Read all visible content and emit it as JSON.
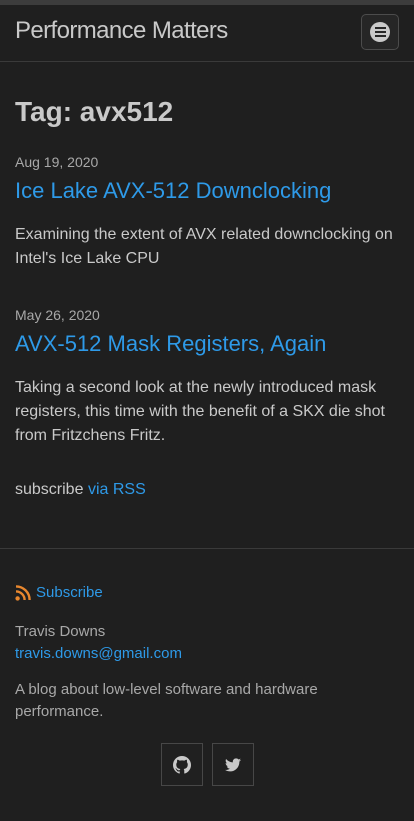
{
  "header": {
    "site_title": "Performance Matters",
    "menu_icon": "bars-circle-icon"
  },
  "page": {
    "heading": "Tag: avx512"
  },
  "posts": [
    {
      "date": "Aug 19, 2020",
      "title": "Ice Lake AVX-512 Downclocking",
      "excerpt": "Examining the extent of AVX related downclocking on Intel's Ice Lake CPU"
    },
    {
      "date": "May 26, 2020",
      "title": "AVX-512 Mask Registers, Again",
      "excerpt": "Taking a second look at the newly introduced mask registers, this time with the benefit of a SKX die shot from Fritzchens Fritz."
    }
  ],
  "subscribe": {
    "prefix": "subscribe",
    "link": "via RSS"
  },
  "footer": {
    "rss_label": "Subscribe",
    "rss_icon": "rss-icon",
    "author": "Travis Downs",
    "email": "travis.downs@gmail.com",
    "blurb": "A blog about low-level software and hardware performance.",
    "social": [
      "github-icon",
      "twitter-icon"
    ]
  },
  "colors": {
    "background": "#1f1f1f",
    "text": "#c9c9c9",
    "muted": "#a8a8a8",
    "link": "#2e9ae8",
    "rss": "#e8872e"
  }
}
